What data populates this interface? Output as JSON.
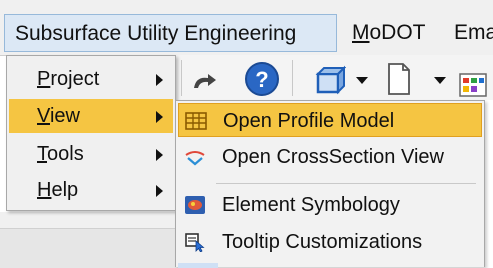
{
  "menubar": {
    "items": [
      {
        "label": "Subsurface Utility Engineering"
      },
      {
        "label_underlined": "M",
        "label_rest": "oDOT"
      },
      {
        "label": "Ema"
      }
    ]
  },
  "menu": {
    "items": [
      {
        "label_underlined": "P",
        "label_rest": "roject"
      },
      {
        "label_underlined": "V",
        "label_rest": "iew"
      },
      {
        "label_underlined": "T",
        "label_rest": "ools"
      },
      {
        "label_underlined": "H",
        "label_rest": "elp"
      }
    ],
    "highlighted_index": 1
  },
  "submenu": {
    "items": [
      {
        "label": "Open Profile Model",
        "icon": "grid-table-icon"
      },
      {
        "label": "Open CrossSection View",
        "icon": "crosssection-icon"
      },
      {
        "label": "Element Symbology",
        "icon": "symbology-icon"
      },
      {
        "label": "Tooltip Customizations",
        "icon": "tooltip-cursor-icon"
      }
    ],
    "highlighted_index": 0
  },
  "toolbar": {
    "icons": [
      "redo-icon",
      "help-icon",
      "view-cube-icon",
      "dropdown-arrow-icon",
      "document-icon",
      "dropdown-arrow-icon",
      "palette-icon"
    ],
    "help_glyph": "?"
  },
  "colors": {
    "highlight": "#f5c542",
    "menubar_active": "#dce8f5",
    "menu_bg": "#f0f0f0"
  }
}
